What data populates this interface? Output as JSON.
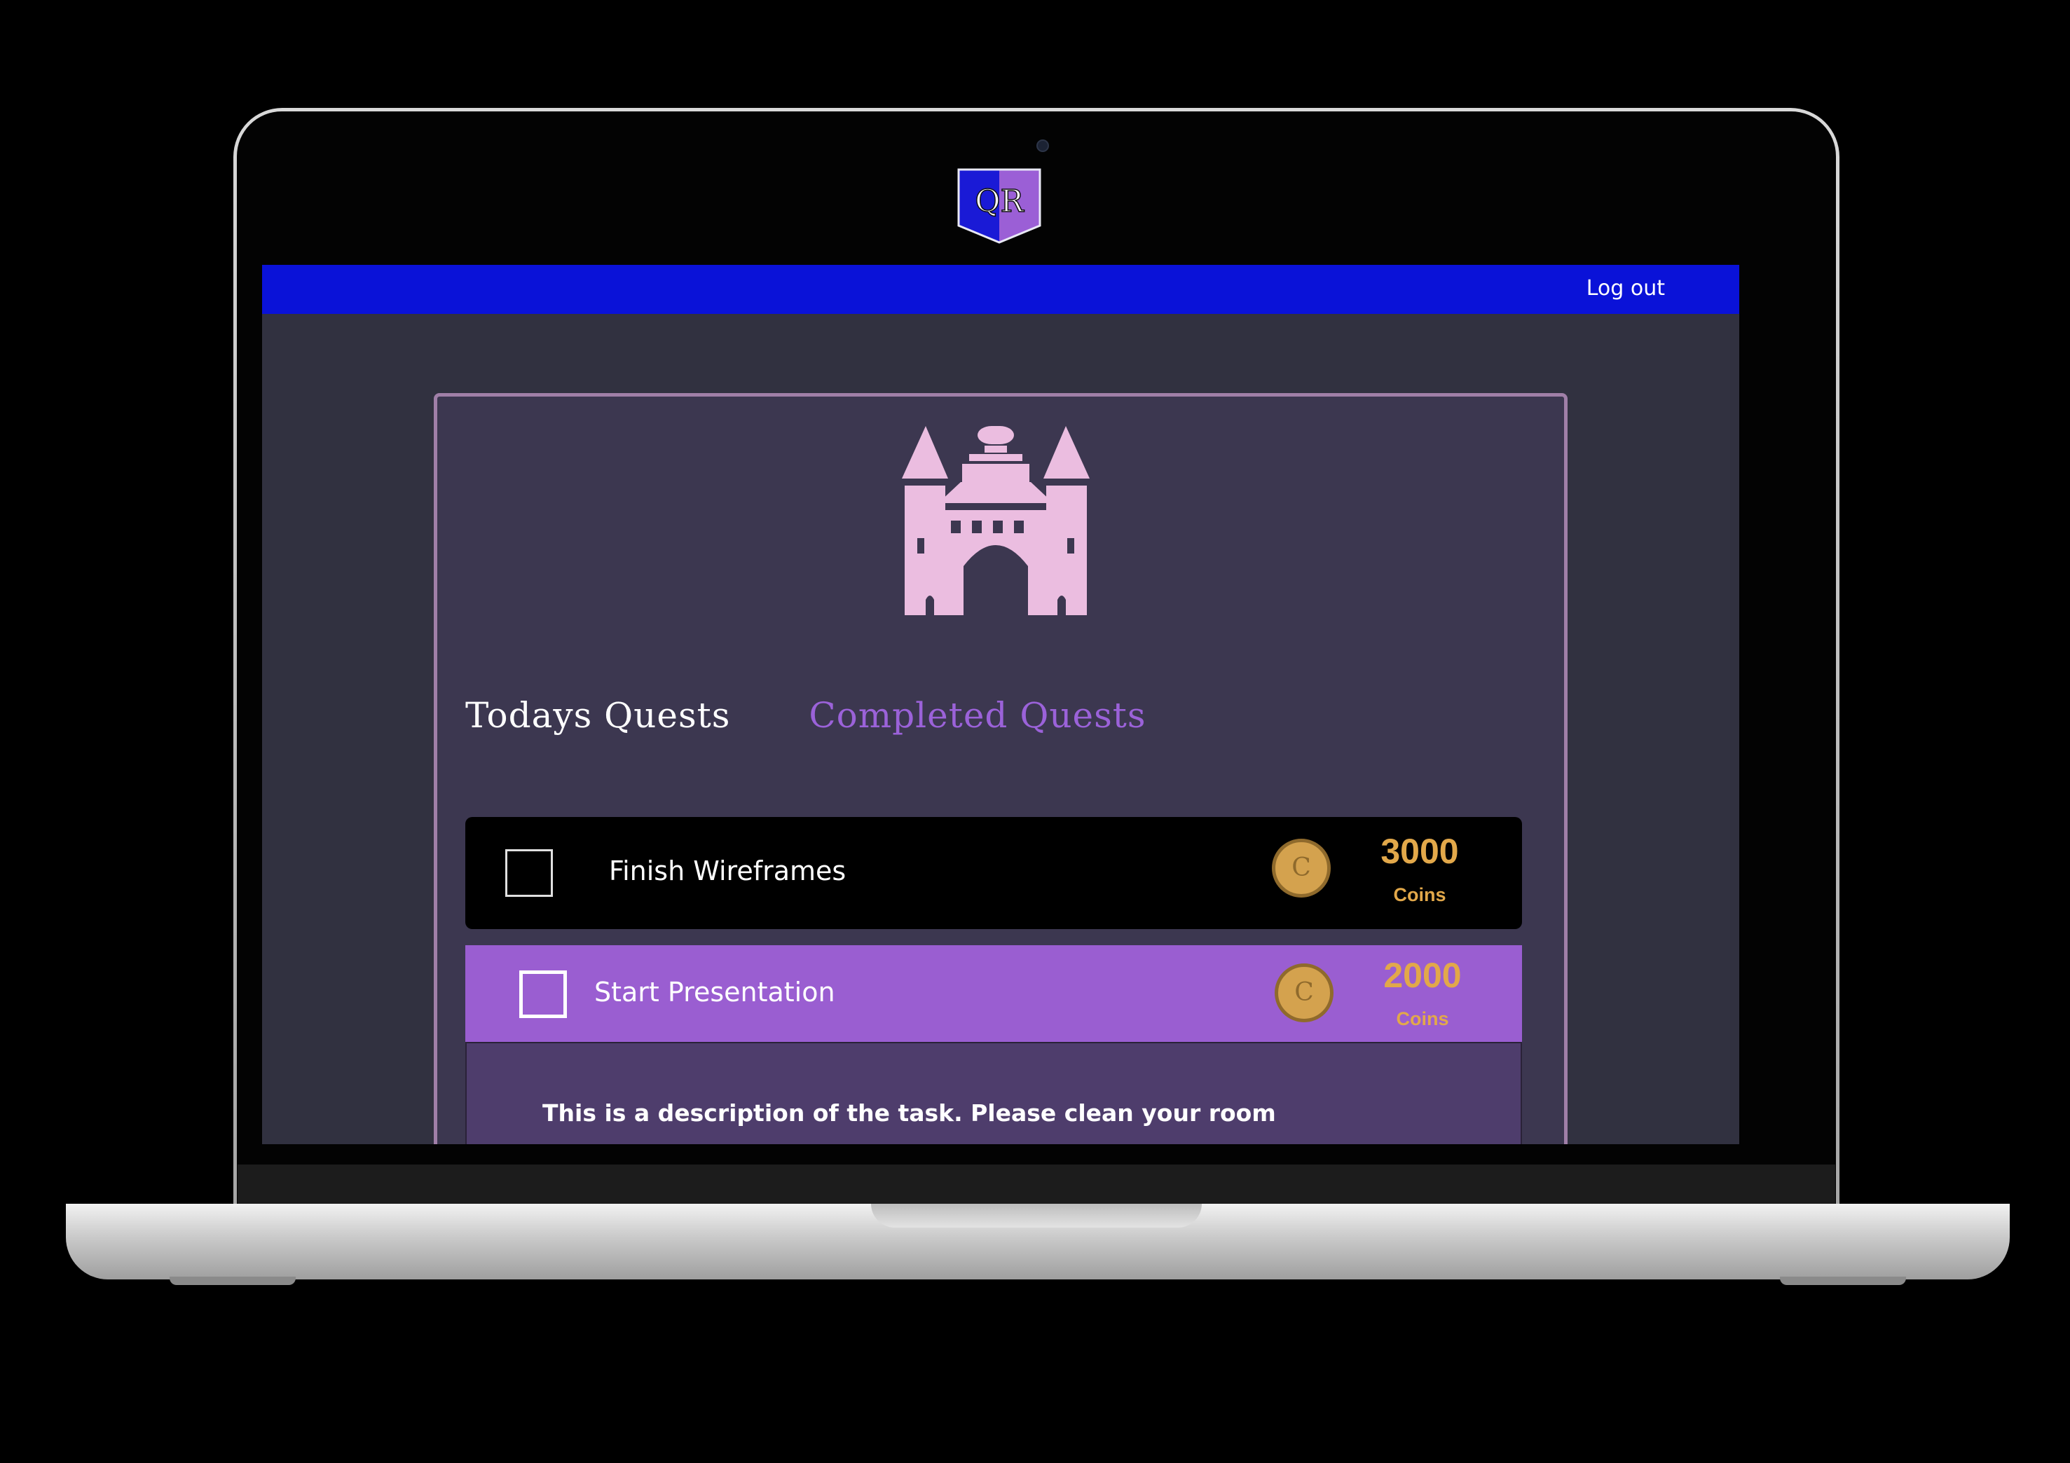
{
  "brand": {
    "logo_text": "QR",
    "logo_colors": [
      "#1a1ad6",
      "#9b5fd6"
    ]
  },
  "header": {
    "logout_label": "Log out",
    "bar_color": "#0a12d8"
  },
  "tabs": [
    {
      "label": "Todays Quests",
      "active": true
    },
    {
      "label": "Completed Quests",
      "active": false
    }
  ],
  "quests": [
    {
      "title": "Finish Wireframes",
      "coins": "3000",
      "unit": "Coins",
      "checked": false,
      "expanded": false
    },
    {
      "title": "Start Presentation",
      "coins": "2000",
      "unit": "Coins",
      "checked": false,
      "expanded": true,
      "description": "This is a description of the task. Please clean your room"
    }
  ],
  "icons": {
    "castle": "castle-icon",
    "coin": "coin-icon",
    "coin_glyph": "C"
  },
  "colors": {
    "accent_purple": "#9b62d9",
    "coin_gold": "#e2a84a",
    "castle_pink": "#ebbde0"
  }
}
